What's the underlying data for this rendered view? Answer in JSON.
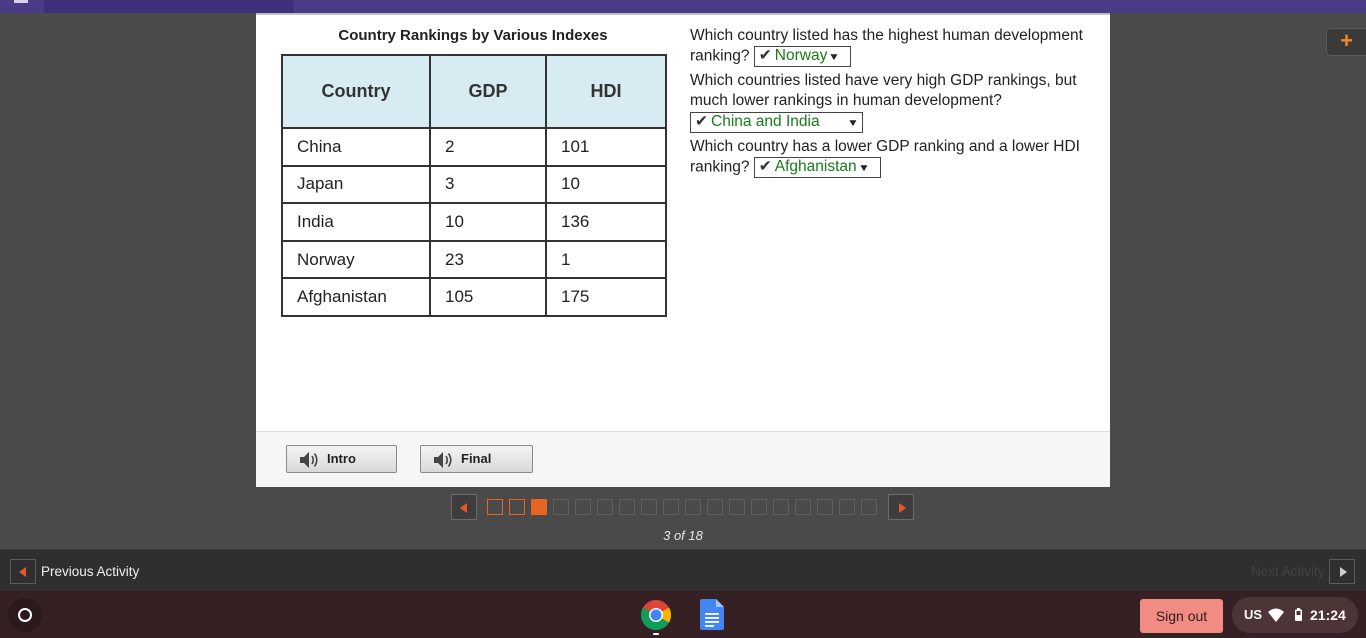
{
  "window": {
    "accent_color": "#4b3a86"
  },
  "table": {
    "title": "Country Rankings by Various Indexes",
    "headers": [
      "Country",
      "GDP",
      "HDI"
    ],
    "rows": [
      {
        "country": "China",
        "gdp": "2",
        "hdi": "101"
      },
      {
        "country": "Japan",
        "gdp": "3",
        "hdi": "10"
      },
      {
        "country": "India",
        "gdp": "10",
        "hdi": "136"
      },
      {
        "country": "Norway",
        "gdp": "23",
        "hdi": "1"
      },
      {
        "country": "Afghanistan",
        "gdp": "105",
        "hdi": "175"
      }
    ]
  },
  "questions": [
    {
      "text": "Which country listed has the highest human development ranking?",
      "answer": "Norway",
      "status": "correct"
    },
    {
      "text": "Which countries listed have very high GDP rankings, but much lower rankings in human development?",
      "answer": "China and India",
      "status": "correct"
    },
    {
      "text": "Which country has a lower GDP ranking and a lower HDI ranking?",
      "answer": "Afghanistan",
      "status": "correct"
    }
  ],
  "check_mark": "✔",
  "audio_buttons": {
    "intro_label": "Intro",
    "final_label": "Final"
  },
  "pager": {
    "current": 3,
    "total": 18,
    "visited": [
      1,
      2
    ],
    "label": "3 of 18",
    "accent": "#e8651f"
  },
  "activity_nav": {
    "previous_label": "Previous Activity",
    "next_label": "Next Activity"
  },
  "shelf": {
    "sign_out_label": "Sign out",
    "ime_label": "US",
    "clock": "21:24",
    "apps": [
      "chrome-icon",
      "google-docs-icon"
    ],
    "sign_out_color": "#f28b82"
  }
}
